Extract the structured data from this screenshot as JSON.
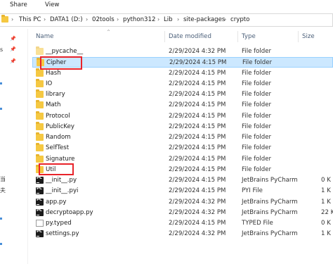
{
  "ribbon": {
    "share_tab": "Share",
    "view_tab": "View"
  },
  "address": {
    "crumbs": [
      "This PC",
      "DATA1 (D:)",
      "02tools",
      "python312",
      "Lib",
      "site-packages",
      "crypto"
    ]
  },
  "nav": {
    "fragments": [
      "s",
      "当",
      "夫"
    ]
  },
  "columns": {
    "name": "Name",
    "date": "Date modified",
    "type": "Type",
    "size": "Size"
  },
  "files": [
    {
      "name": "__pycache__",
      "date": "2/29/2024 4:32 PM",
      "type": "File folder",
      "size": "",
      "icon": "folder-icon",
      "faded": true,
      "selected": false
    },
    {
      "name": "Cipher",
      "date": "2/29/2024 4:15 PM",
      "type": "File folder",
      "size": "",
      "icon": "folder-icon",
      "selected": true
    },
    {
      "name": "Hash",
      "date": "2/29/2024 4:15 PM",
      "type": "File folder",
      "size": "",
      "icon": "folder-icon"
    },
    {
      "name": "IO",
      "date": "2/29/2024 4:15 PM",
      "type": "File folder",
      "size": "",
      "icon": "folder-icon"
    },
    {
      "name": "library",
      "date": "2/29/2024 4:15 PM",
      "type": "File folder",
      "size": "",
      "icon": "folder-icon"
    },
    {
      "name": "Math",
      "date": "2/29/2024 4:15 PM",
      "type": "File folder",
      "size": "",
      "icon": "folder-icon"
    },
    {
      "name": "Protocol",
      "date": "2/29/2024 4:15 PM",
      "type": "File folder",
      "size": "",
      "icon": "folder-icon"
    },
    {
      "name": "PublicKey",
      "date": "2/29/2024 4:15 PM",
      "type": "File folder",
      "size": "",
      "icon": "folder-icon"
    },
    {
      "name": "Random",
      "date": "2/29/2024 4:15 PM",
      "type": "File folder",
      "size": "",
      "icon": "folder-icon"
    },
    {
      "name": "SelfTest",
      "date": "2/29/2024 4:15 PM",
      "type": "File folder",
      "size": "",
      "icon": "folder-icon"
    },
    {
      "name": "Signature",
      "date": "2/29/2024 4:15 PM",
      "type": "File folder",
      "size": "",
      "icon": "folder-icon"
    },
    {
      "name": "Util",
      "date": "2/29/2024 4:15 PM",
      "type": "File folder",
      "size": "",
      "icon": "folder-icon"
    },
    {
      "name": "__init__.py",
      "date": "2/29/2024 4:15 PM",
      "type": "JetBrains PyCharm",
      "size": "0 K",
      "icon": "pycharm-file-icon"
    },
    {
      "name": "__init__.pyi",
      "date": "2/29/2024 4:15 PM",
      "type": "PYI File",
      "size": "1 K",
      "icon": "pycharm-file-icon"
    },
    {
      "name": "app.py",
      "date": "2/29/2024 4:32 PM",
      "type": "JetBrains PyCharm",
      "size": "1 K",
      "icon": "pycharm-file-icon"
    },
    {
      "name": "decryptoapp.py",
      "date": "2/29/2024 4:32 PM",
      "type": "JetBrains PyCharm",
      "size": "22 K",
      "icon": "pycharm-file-icon"
    },
    {
      "name": "py.typed",
      "date": "2/29/2024 4:15 PM",
      "type": "TYPED File",
      "size": "0 K",
      "icon": "generic-file-icon"
    },
    {
      "name": "settings.py",
      "date": "2/29/2024 4:32 PM",
      "type": "JetBrains PyCharm",
      "size": "1 K",
      "icon": "pycharm-file-icon"
    }
  ],
  "annotations": {
    "highlight_color": "#e8232a",
    "highlighted_items": [
      "Cipher",
      "Util"
    ]
  },
  "colors": {
    "selection_bg": "#cce8ff",
    "selection_border": "#99d1ff",
    "folder": "#f5c842"
  }
}
